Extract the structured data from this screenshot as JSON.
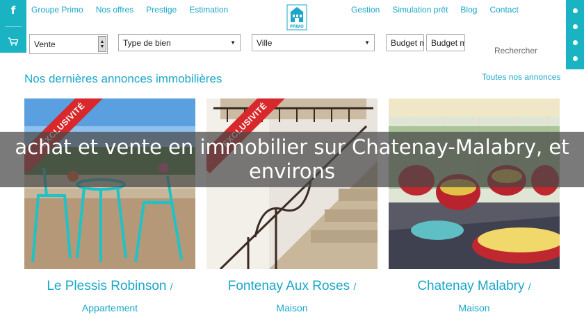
{
  "social": {
    "facebook_icon": "f",
    "cart_icon": "🛒"
  },
  "nav": {
    "left": [
      "Groupe Primo",
      "Nos offres",
      "Prestige",
      "Estimation"
    ],
    "right": [
      "Gestion",
      "Simulation prêt",
      "Blog",
      "Contact"
    ]
  },
  "logo_text": "PRIMO",
  "search": {
    "transaction": "Vente",
    "property_type": "Type de bien",
    "city": "Ville",
    "budget_min": "Budget mi",
    "budget_max": "Budget ma",
    "submit": "Rechercher"
  },
  "section": {
    "title": "Nos dernières annonces immobilières",
    "all_link": "Toutes nos annonces"
  },
  "listings": [
    {
      "city": "Le Plessis Robinson",
      "type": "Appartement",
      "badge": "EXCLUSIVITÉ"
    },
    {
      "city": "Fontenay Aux Roses",
      "type": "Maison",
      "badge": "EXCLUSIVITÉ"
    },
    {
      "city": "Chatenay Malabry",
      "type": "Maison",
      "badge": ""
    }
  ],
  "overlay": {
    "headline": "achat et vente en immobilier sur Chatenay-Malabry, et environs"
  },
  "colors": {
    "accent": "#1ab3c4",
    "link": "#1aa7c9",
    "ribbon": "#d8282b"
  }
}
